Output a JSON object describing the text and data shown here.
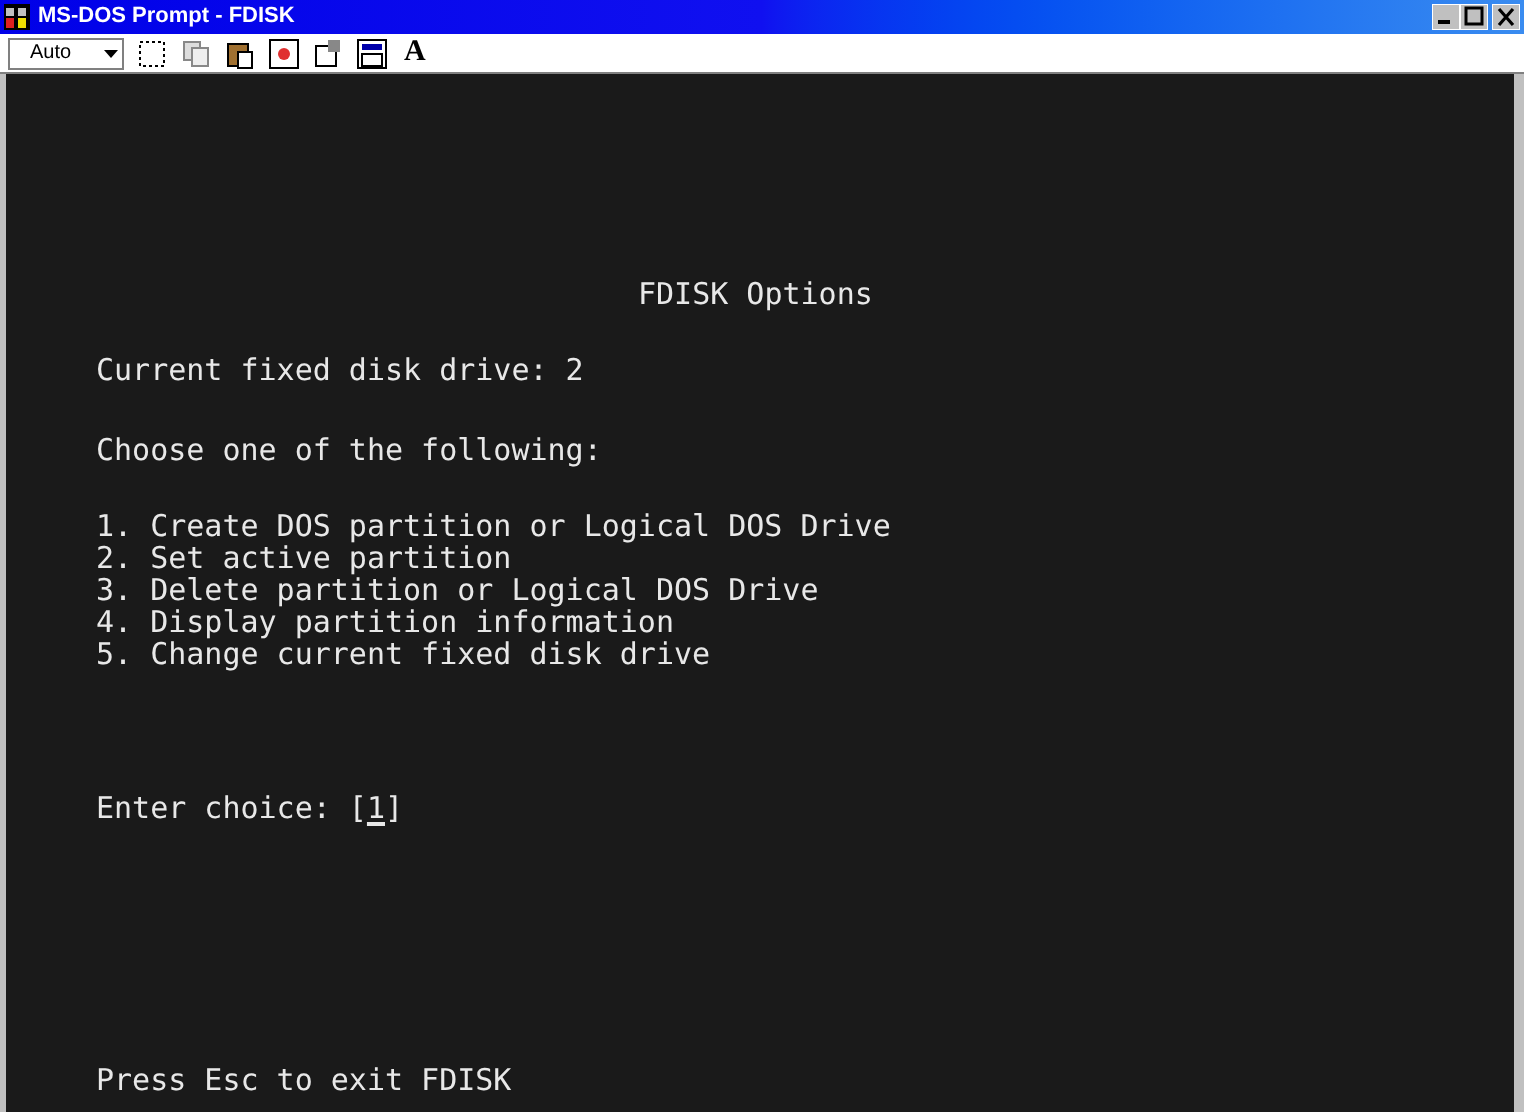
{
  "window": {
    "title": "MS-DOS Prompt - FDISK"
  },
  "toolbar": {
    "font_size": "Auto",
    "font_button": "A"
  },
  "terminal": {
    "heading": "FDISK Options",
    "current_drive": "Current fixed disk drive: 2",
    "prompt": "Choose one of the following:",
    "options": [
      "1. Create DOS partition or Logical DOS Drive",
      "2. Set active partition",
      "3. Delete partition or Logical DOS Drive",
      "4. Display partition information",
      "5. Change current fixed disk drive"
    ],
    "choice_label": "Enter choice: [",
    "choice_value": "1",
    "choice_end": "]",
    "footer": "Press Esc to exit FDISK"
  }
}
